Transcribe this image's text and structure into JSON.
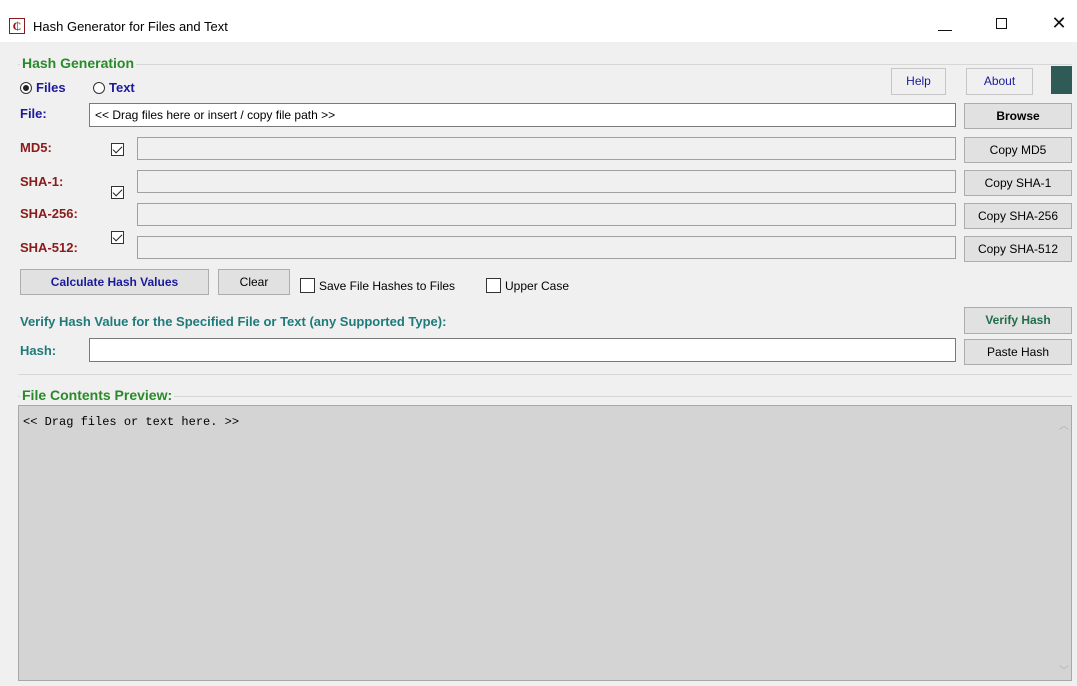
{
  "window": {
    "title": "Hash Generator for Files and Text",
    "app_icon_glyph": "₵",
    "close_glyph": "✕"
  },
  "hash_generation": {
    "group_title": "Hash Generation",
    "mode_files_label": "Files",
    "mode_text_label": "Text",
    "selected_mode": "Files",
    "help_label": "Help",
    "about_label": "About",
    "file_label": "File:",
    "file_placeholder": "<< Drag files here or insert / copy file path >>",
    "browse_label": "Browse",
    "algorithms": [
      {
        "label": "MD5:",
        "checked": true,
        "value": "",
        "copy_label": "Copy MD5"
      },
      {
        "label": "SHA-1:",
        "checked": true,
        "value": "",
        "copy_label": "Copy SHA-1"
      },
      {
        "label": "SHA-256:",
        "checked": true,
        "value": "",
        "copy_label": "Copy SHA-256"
      },
      {
        "label": "SHA-512:",
        "checked": false,
        "value": "",
        "copy_label": "Copy SHA-512"
      }
    ],
    "calculate_label": "Calculate Hash Values",
    "clear_label": "Clear",
    "save_hashes_label": "Save File Hashes to Files",
    "save_hashes_checked": false,
    "upper_case_label": "Upper Case",
    "upper_case_checked": false
  },
  "verify": {
    "heading": "Verify Hash Value for the Specified File or Text (any Supported Type):",
    "verify_label": "Verify Hash",
    "hash_label": "Hash:",
    "hash_value": "",
    "paste_label": "Paste Hash"
  },
  "preview": {
    "group_title": "File Contents Preview:",
    "placeholder": "<< Drag files or text here. >>",
    "scroll_up_glyph": "︿",
    "scroll_down_glyph": "﹀"
  },
  "colors": {
    "group_title": "#2a8a2a",
    "algo_label": "#8b1a1a",
    "mode_label": "#1a1a9c",
    "verify_heading": "#1f7a7a",
    "accent_block": "#2f5a56",
    "preview_bg": "#d4d4d4"
  }
}
